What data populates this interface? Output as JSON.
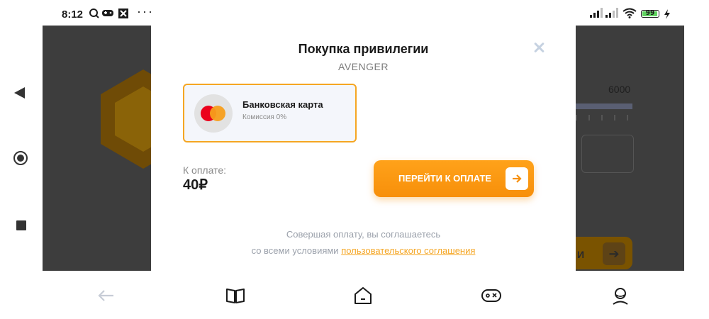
{
  "status_bar": {
    "time": "8:12",
    "battery": "99",
    "battery_level_percent": 99,
    "icons": [
      "q-search-icon",
      "gamepad-icon",
      "box-x-icon",
      "more-icon",
      "signal-icon",
      "signal-icon",
      "wifi-icon",
      "battery-icon",
      "charging-icon"
    ]
  },
  "background": {
    "amount": "6000",
    "button_label": "И"
  },
  "modal": {
    "title": "Покупка привилегии",
    "subtitle": "AVENGER",
    "close_icon": "close-icon",
    "payment_method": {
      "name": "Банковская карта",
      "fee": "Комиссия 0%",
      "icon": "mastercard-icon"
    },
    "total_label": "К оплате:",
    "total_value": "40₽",
    "pay_button": "ПЕРЕЙТИ К ОПЛАТЕ",
    "pay_button_icon": "arrow-right-icon",
    "agreement_text_line1": "Совершая оплату, вы соглашаетесь",
    "agreement_text_line2": "со всеми условиями",
    "agreement_link": "пользовательского соглашения"
  },
  "bottom_tabs": [
    {
      "icon": "back-arrow-icon"
    },
    {
      "icon": "book-icon"
    },
    {
      "icon": "home-icon"
    },
    {
      "icon": "gamepad-icon"
    },
    {
      "icon": "profile-icon"
    }
  ],
  "colors": {
    "accent": "#f5a623",
    "button_gradient_top": "#ffa21a",
    "button_gradient_bottom": "#f78f0a",
    "overlay": "#6f6f6f"
  }
}
